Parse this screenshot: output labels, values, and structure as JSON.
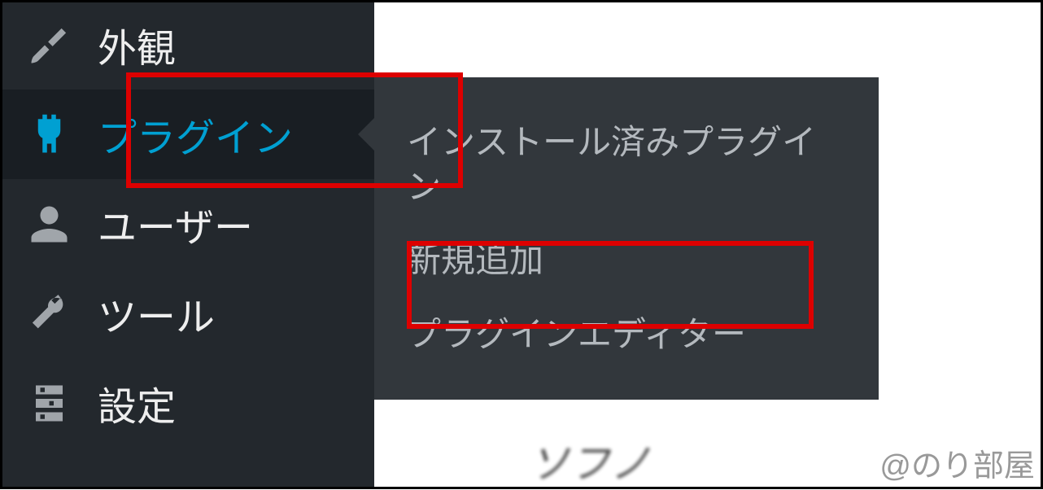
{
  "sidebar": {
    "items": [
      {
        "label": "外観",
        "icon": "brush-icon"
      },
      {
        "label": "プラグイン",
        "icon": "plugin-icon",
        "active": true
      },
      {
        "label": "ユーザー",
        "icon": "user-icon"
      },
      {
        "label": "ツール",
        "icon": "wrench-icon"
      },
      {
        "label": "設定",
        "icon": "settings-icon"
      }
    ]
  },
  "submenu": {
    "items": [
      {
        "label": "インストール済みプラグイン"
      },
      {
        "label": "新規追加"
      },
      {
        "label": "プラグインエディター"
      }
    ]
  },
  "watermark": "@のり部屋",
  "bg_text": "ソフノ"
}
